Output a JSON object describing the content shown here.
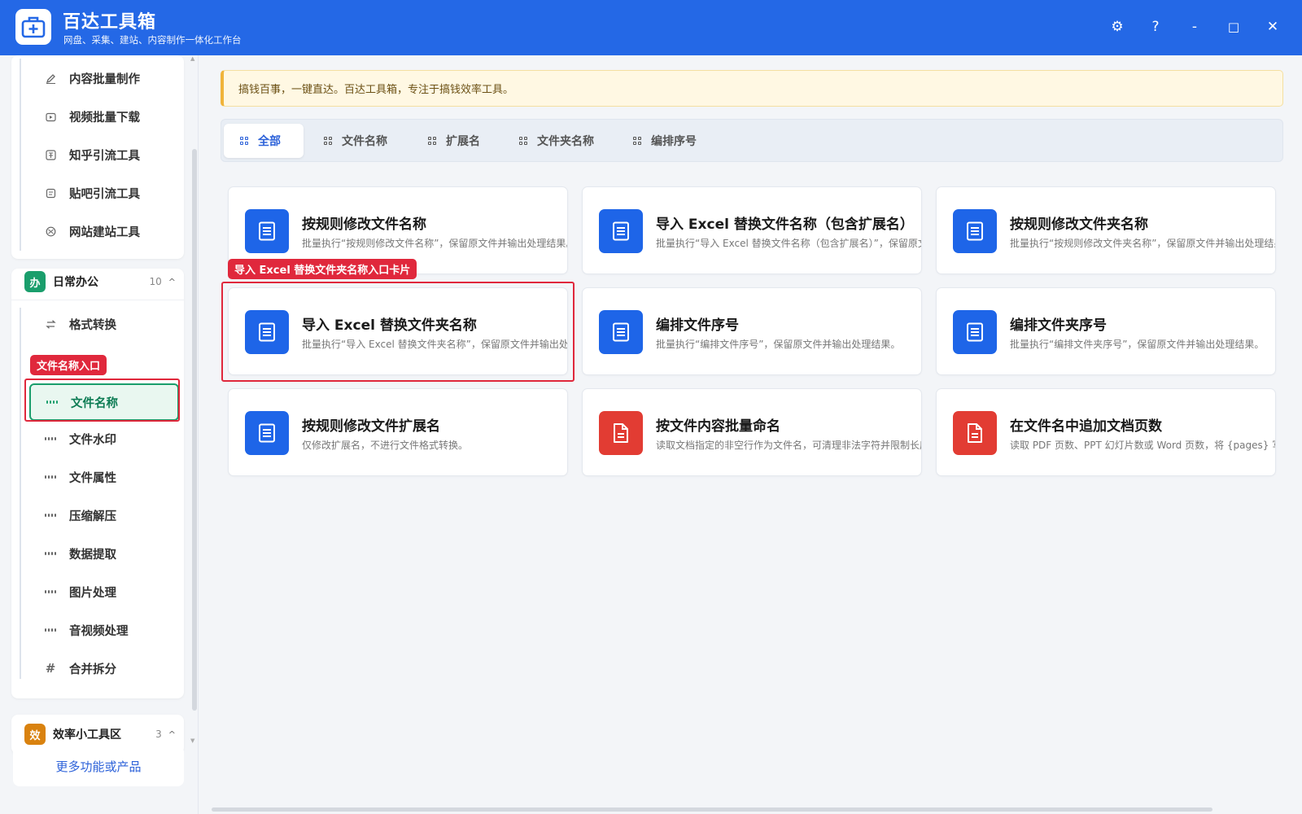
{
  "app": {
    "title": "百达工具箱",
    "subtitle": "网盘、采集、建站、内容制作一体化工作台"
  },
  "titlebar_buttons": {
    "settings": "⚙",
    "help": "?",
    "minimize": "-",
    "maximize": "□",
    "close": "✕"
  },
  "sidebar": {
    "top_items": [
      {
        "label": "内容批量制作",
        "icon": "pen-icon"
      },
      {
        "label": "视频批量下载",
        "icon": "video-icon"
      },
      {
        "label": "知乎引流工具",
        "icon": "zhihu-icon"
      },
      {
        "label": "贴吧引流工具",
        "icon": "tieba-icon"
      },
      {
        "label": "网站建站工具",
        "icon": "globe-icon"
      }
    ],
    "office_group": {
      "badge": "办",
      "badge_color": "#1a9e6c",
      "name": "日常办公",
      "count": "10",
      "caret": "^",
      "items": [
        {
          "label": "格式转换",
          "icon": "swap-icon"
        },
        {
          "label": "文件名称",
          "icon": "grid-icon"
        },
        {
          "label": "文件水印",
          "icon": "grid-icon"
        },
        {
          "label": "文件属性",
          "icon": "grid-icon"
        },
        {
          "label": "压缩解压",
          "icon": "grid-icon"
        },
        {
          "label": "数据提取",
          "icon": "grid-icon"
        },
        {
          "label": "图片处理",
          "icon": "grid-icon"
        },
        {
          "label": "音视频处理",
          "icon": "grid-icon"
        },
        {
          "label": "合并拆分",
          "icon": "hash-icon"
        }
      ]
    },
    "efficiency_group": {
      "badge": "效",
      "badge_color": "#d9820f",
      "name": "效率小工具区",
      "count": "3",
      "caret": "^"
    },
    "more_button": "更多功能或产品"
  },
  "annotations": {
    "sidebar_tag": "文件名称入口",
    "card_tag": "导入 Excel 替换文件夹名称入口卡片"
  },
  "notice": "搞钱百事，一键直达。百达工具箱，专注于搞钱效率工具。",
  "tabs": [
    {
      "label": "全部",
      "active": true
    },
    {
      "label": "文件名称",
      "active": false
    },
    {
      "label": "扩展名",
      "active": false
    },
    {
      "label": "文件夹名称",
      "active": false
    },
    {
      "label": "编排序号",
      "active": false
    }
  ],
  "cards": [
    {
      "title": "按规则修改文件名称",
      "desc": "批量执行“按规则修改文件名称”，保留原文件并输出处理结果。",
      "icon": "document-icon",
      "color": "blue"
    },
    {
      "title": "导入 Excel 替换文件名称（包含扩展名）",
      "desc": "批量执行“导入 Excel 替换文件名称（包含扩展名）”，保留原文件",
      "icon": "document-icon",
      "color": "blue"
    },
    {
      "title": "按规则修改文件夹名称",
      "desc": "批量执行“按规则修改文件夹名称”，保留原文件并输出处理结果。",
      "icon": "document-icon",
      "color": "blue"
    },
    {
      "title": "导入 Excel 替换文件夹名称",
      "desc": "批量执行“导入 Excel 替换文件夹名称”，保留原文件并输出处理结",
      "icon": "document-icon",
      "color": "blue"
    },
    {
      "title": "编排文件序号",
      "desc": "批量执行“编排文件序号”，保留原文件并输出处理结果。",
      "icon": "document-icon",
      "color": "blue"
    },
    {
      "title": "编排文件夹序号",
      "desc": "批量执行“编排文件夹序号”，保留原文件并输出处理结果。",
      "icon": "document-icon",
      "color": "blue"
    },
    {
      "title": "按规则修改文件扩展名",
      "desc": "仅修改扩展名，不进行文件格式转换。",
      "icon": "document-icon",
      "color": "blue"
    },
    {
      "title": "按文件内容批量命名",
      "desc": "读取文档指定的非空行作为文件名，可清理非法字符并限制长度；",
      "icon": "file-icon",
      "color": "red"
    },
    {
      "title": "在文件名中追加文档页数",
      "desc": "读取 PDF 页数、PPT 幻灯片数或 Word 页数，将 {pages} 写入命名",
      "icon": "file-icon",
      "color": "red"
    }
  ]
}
